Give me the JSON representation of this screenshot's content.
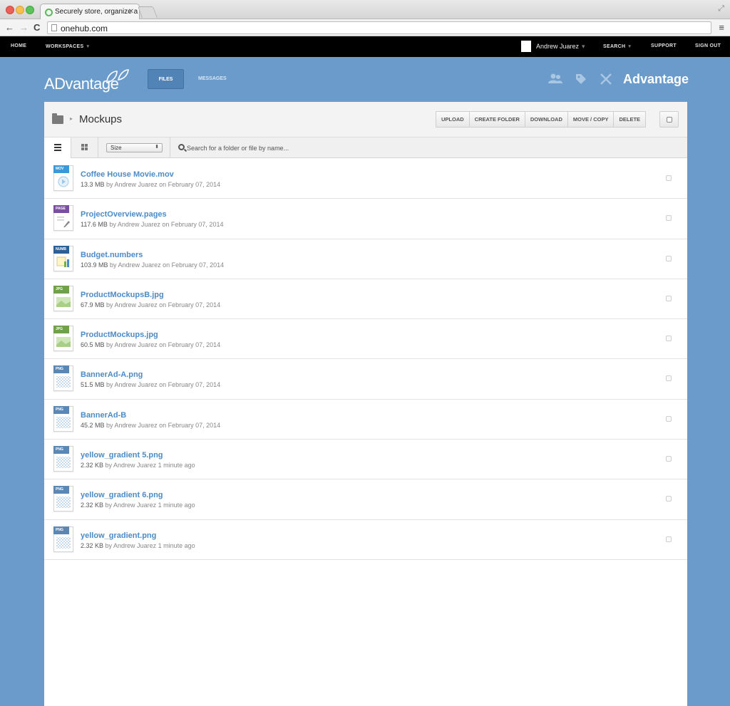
{
  "browser": {
    "tab_title": "Securely store, organize a",
    "tab_close": "✕",
    "url": "onehub.com",
    "icons": [
      "back-arrow-icon",
      "forward-arrow-icon",
      "reload-icon",
      "menu-icon",
      "page-icon",
      "resize-icon"
    ]
  },
  "appnav": {
    "home": "HOME",
    "workspaces": "WORKSPACES",
    "caret": "▾",
    "user_name": "Andrew Juarez",
    "search": "SEARCH",
    "support": "SUPPORT",
    "sign_out": "SIGN OUT"
  },
  "workspace": {
    "logo_text": "ADvantage",
    "tabs": [
      {
        "label": "FILES",
        "active": true
      },
      {
        "label": "MESSAGES",
        "active": false
      }
    ],
    "name": "Advantage",
    "header_icons": [
      "members-icon",
      "tag-icon",
      "settings-tools-icon"
    ]
  },
  "folder": {
    "title": "Mockups",
    "crumb_caret": "▸"
  },
  "actions": [
    "UPLOAD",
    "CREATE FOLDER",
    "DOWNLOAD",
    "MOVE / COPY",
    "DELETE"
  ],
  "toolbar": {
    "sort_value": "Size",
    "sort_arrows": "⬍",
    "search_placeholder": "Search for a folder or file by name..."
  },
  "files": [
    {
      "name": "Coffee House Movie.mov",
      "type": "MOV",
      "size": "13.3 MB",
      "meta": " by Andrew Juarez on February 07, 2014"
    },
    {
      "name": "ProjectOverview.pages",
      "type": "PAGE",
      "size": "117.6 MB",
      "meta": " by Andrew Juarez on February 07, 2014"
    },
    {
      "name": "Budget.numbers",
      "type": "NUMB",
      "size": "103.9 MB",
      "meta": " by Andrew Juarez on February 07, 2014"
    },
    {
      "name": "ProductMockupsB.jpg",
      "type": "JPG",
      "size": "67.9 MB",
      "meta": " by Andrew Juarez on February 07, 2014"
    },
    {
      "name": "ProductMockups.jpg",
      "type": "JPG",
      "size": "60.5 MB",
      "meta": " by Andrew Juarez on February 07, 2014"
    },
    {
      "name": "BannerAd-A.png",
      "type": "PNG",
      "size": "51.5 MB",
      "meta": " by Andrew Juarez on February 07, 2014"
    },
    {
      "name": "BannerAd-B",
      "type": "PNG",
      "size": "45.2 MB",
      "meta": " by Andrew Juarez on February 07, 2014"
    },
    {
      "name": "yellow_gradient 5.png",
      "type": "PNG",
      "size": "2.32 KB",
      "meta": " by Andrew Juarez 1 minute ago"
    },
    {
      "name": "yellow_gradient 6.png",
      "type": "PNG",
      "size": "2.32 KB",
      "meta": " by Andrew Juarez 1 minute ago"
    },
    {
      "name": "yellow_gradient.png",
      "type": "PNG",
      "size": "2.32 KB",
      "meta": " by Andrew Juarez 1 minute ago"
    }
  ],
  "type_colors": {
    "MOV": "#3a9ad9",
    "PAGE": "#7c4ea0",
    "NUMB": "#2d5f99",
    "JPG": "#6fa14a",
    "PNG": "#5d87b3"
  },
  "colors": {
    "page_background": "#6a9bcb",
    "link": "#4d8bc6",
    "nav_background": "#000000"
  }
}
